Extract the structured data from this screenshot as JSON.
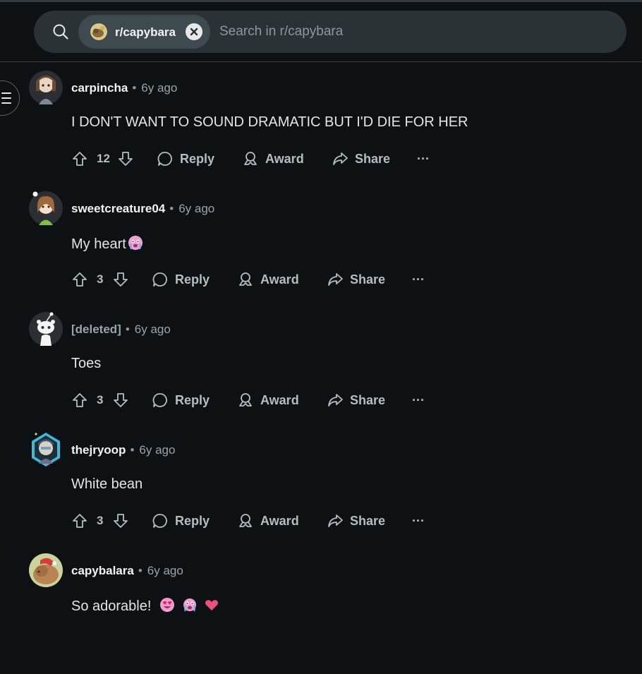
{
  "search": {
    "community_chip": "r/capybara",
    "placeholder": "Search in r/capybara"
  },
  "actions": {
    "reply": "Reply",
    "award": "Award",
    "share": "Share",
    "more": "···"
  },
  "comments": [
    {
      "author": "carpincha",
      "time": "6y ago",
      "body": "I DON'T WANT TO SOUND DRAMATIC BUT I'D DIE FOR HER",
      "votes": "12"
    },
    {
      "author": "sweetcreature04",
      "time": "6y ago",
      "body": "My heart",
      "votes": "3",
      "emojis": [
        "crying-face"
      ]
    },
    {
      "author": "[deleted]",
      "time": "6y ago",
      "body": "Toes",
      "votes": "3"
    },
    {
      "author": "thejryoop",
      "time": "6y ago",
      "body": "White bean",
      "votes": "3"
    },
    {
      "author": "capybalara",
      "time": "6y ago",
      "body": "So adorable!",
      "emojis": [
        "heart-eyes-face",
        "crying-face",
        "pink-heart"
      ]
    }
  ],
  "colors": {
    "background": "#0e1113",
    "search_bg": "#2a3236",
    "chip_bg": "#3e4a4f",
    "text": "#d7dadc",
    "muted": "#9aa3a8"
  }
}
